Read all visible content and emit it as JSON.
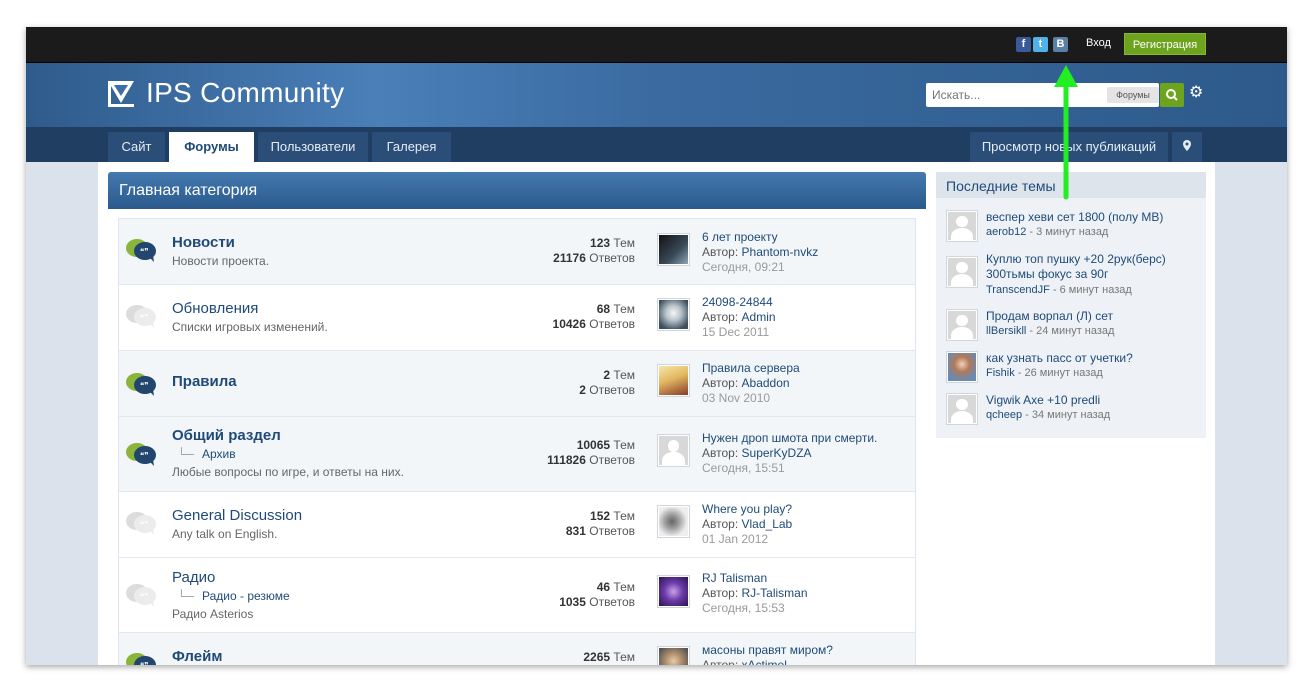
{
  "topbar": {
    "social": [
      {
        "name": "facebook",
        "glyph": "f",
        "color": "#3b5998"
      },
      {
        "name": "twitter",
        "glyph": "t",
        "color": "#4fb3e8"
      },
      {
        "name": "vkontakte",
        "glyph": "B",
        "color": "#5b7fa6"
      }
    ],
    "sign_in": "Вход",
    "register": "Регистрация"
  },
  "header": {
    "logo_text": "IPS Community",
    "search_placeholder": "Искать...",
    "search_scope": "Форумы"
  },
  "nav": {
    "tabs": [
      "Сайт",
      "Форумы",
      "Пользователи",
      "Галерея"
    ],
    "active_tab": "Форумы",
    "new_posts": "Просмотр новых публикаций"
  },
  "category": {
    "title": "Главная категория",
    "forums": [
      {
        "name": "Новости",
        "desc": "Новости проекта.",
        "topics": "123",
        "replies": "21176",
        "last_title": "6 лет проекту",
        "last_author": "Phantom-nvkz",
        "last_date": "Сегодня, 09:21"
      },
      {
        "name": "Обновления",
        "desc": "Списки игровых изменений.",
        "topics": "68",
        "replies": "10426",
        "last_title": "24098-24844",
        "last_author": "Admin",
        "last_date": "15 Dec 2011"
      },
      {
        "name": "Правила",
        "desc": "",
        "topics": "2",
        "replies": "2",
        "last_title": "Правила сервера",
        "last_author": "Abaddon",
        "last_date": "03 Nov 2010"
      },
      {
        "name": "Общий раздел",
        "sub": "Архив",
        "desc": "Любые вопросы по игре, и ответы на них.",
        "topics": "10065",
        "replies": "111826",
        "last_title": "Нужен дроп шмота при смерти.",
        "last_author": "SuperKyDZA",
        "last_date": "Сегодня, 15:51"
      },
      {
        "name": "General Discussion",
        "desc": "Any talk on English.",
        "topics": "152",
        "replies": "831",
        "last_title": "Where you play?",
        "last_author": "Vlad_Lab",
        "last_date": "01 Jan 2012"
      },
      {
        "name": "Радио",
        "sub": "Радио - резюме",
        "desc": "Радио Asterios",
        "topics": "46",
        "replies": "1035",
        "last_title": "RJ Talisman",
        "last_author": "RJ-Talisman",
        "last_date": "Сегодня, 15:53"
      },
      {
        "name": "Флейм",
        "desc": "",
        "topics": "2265",
        "replies": "",
        "last_title": "масоны правят миром?",
        "last_author": "xActimel",
        "last_date": ""
      }
    ],
    "labels": {
      "topics": "Тем",
      "replies": "Ответов",
      "author": "Автор:"
    }
  },
  "sidebar": {
    "title": "Последние темы",
    "items": [
      {
        "title": "веспер хеви сет 1800 (полу МВ)",
        "user": "aerob12",
        "time": "3 минут назад"
      },
      {
        "title": "Куплю топ пушку +20 2рук(берс) 300тьмы фокус за 90г",
        "user": "TranscendJF",
        "time": "6 минут назад"
      },
      {
        "title": "Продам ворпал (Л) сет",
        "user": "llBersikll",
        "time": "24 минут назад"
      },
      {
        "title": "как узнать пасс от учетки?",
        "user": "Fishik",
        "time": "26 минут назад"
      },
      {
        "title": "Vigwik Axe +10 predli",
        "user": "qcheep",
        "time": "34 минут назад"
      }
    ]
  },
  "colors": {
    "accent_green": "#6ea31d",
    "brand_blue": "#2b5a8d",
    "annotation_arrow": "#22ee22"
  }
}
